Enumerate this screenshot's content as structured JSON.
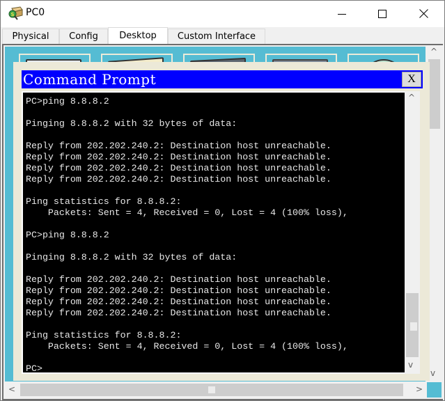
{
  "window": {
    "title": "PC0",
    "icon": "packet-tracer-pc-icon",
    "controls": {
      "minimize": "minimize-icon",
      "maximize": "maximize-icon",
      "close": "close-icon"
    }
  },
  "tabs": [
    {
      "label": "Physical",
      "active": false
    },
    {
      "label": "Config",
      "active": false
    },
    {
      "label": "Desktop",
      "active": true
    },
    {
      "label": "Custom Interface",
      "active": false
    }
  ],
  "desktop": {
    "icons": [
      "ip-configuration-icon",
      "dial-up-icon",
      "terminal-icon",
      "command-prompt-icon",
      "web-browser-icon"
    ]
  },
  "command_prompt": {
    "title": "Command Prompt",
    "close_label": "X",
    "lines": [
      "PC>ping 8.8.8.2",
      "",
      "Pinging 8.8.8.2 with 32 bytes of data:",
      "",
      "Reply from 202.202.240.2: Destination host unreachable.",
      "Reply from 202.202.240.2: Destination host unreachable.",
      "Reply from 202.202.240.2: Destination host unreachable.",
      "Reply from 202.202.240.2: Destination host unreachable.",
      "",
      "Ping statistics for 8.8.8.2:",
      "    Packets: Sent = 4, Received = 0, Lost = 4 (100% loss),",
      "",
      "PC>ping 8.8.8.2",
      "",
      "Pinging 8.8.8.2 with 32 bytes of data:",
      "",
      "Reply from 202.202.240.2: Destination host unreachable.",
      "Reply from 202.202.240.2: Destination host unreachable.",
      "Reply from 202.202.240.2: Destination host unreachable.",
      "Reply from 202.202.240.2: Destination host unreachable.",
      "",
      "Ping statistics for 8.8.8.2:",
      "    Packets: Sent = 4, Received = 0, Lost = 4 (100% loss),",
      "",
      "PC>"
    ]
  },
  "colors": {
    "desktop_bg": "#55bcd3",
    "cmd_header": "#0000ff",
    "terminal_bg": "#000000",
    "terminal_text": "#e8e8e8",
    "panel_bg": "#ece9d8"
  },
  "scroll": {
    "arrows": {
      "up": "^",
      "down": "v",
      "left": "<",
      "right": ">"
    }
  }
}
